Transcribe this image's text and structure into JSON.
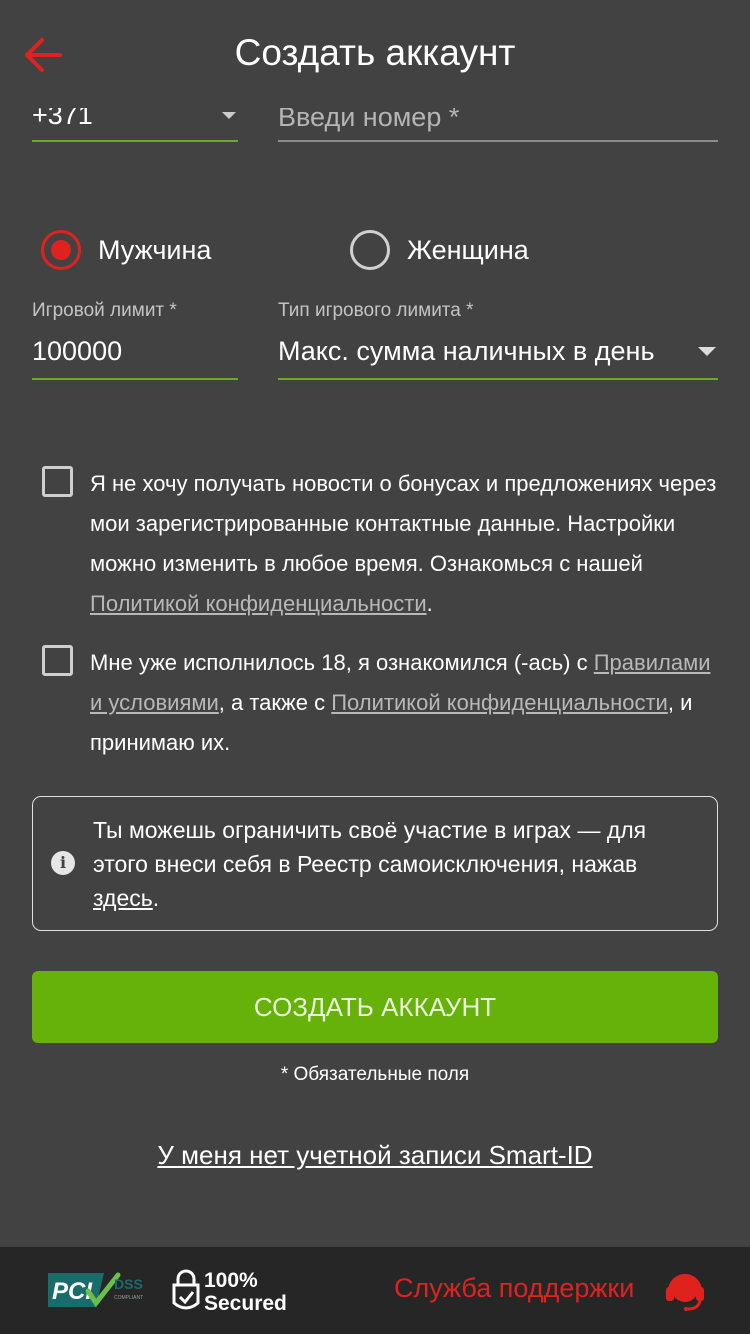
{
  "header": {
    "title": "Создать аккаунт"
  },
  "phone": {
    "code": "+371",
    "placeholder": "Введи номер *"
  },
  "gender": {
    "male_label": "Мужчина",
    "female_label": "Женщина",
    "selected": "male"
  },
  "limits": {
    "amount_label": "Игровой лимит *",
    "amount_value": "100000",
    "type_label": "Тип игрового лимита *",
    "type_value": "Макс. сумма наличных в день"
  },
  "consents": {
    "news": {
      "text_before": "Я не хочу получать новости о бонусах и предложениях через мои зарегистрированные контактные данные. Настройки можно изменить в любое время. Ознакомься с нашей ",
      "link": "Политикой конфиденциальности",
      "text_after": "."
    },
    "age": {
      "text_1": "Мне уже исполнилось 18, я ознакомился (-ась) с ",
      "link_terms": "Правилами и условиями",
      "text_2": ", а также с ",
      "link_privacy": "Политикой конфиденциальности",
      "text_3": ", и принимаю их."
    }
  },
  "info": {
    "text": "Ты можешь ограничить своё участие в играх — для этого внеси себя в Реестр самоисключения, нажав ",
    "link": "здесь",
    "text_after": "."
  },
  "actions": {
    "create_label": "СОЗДАТЬ АККАУНТ",
    "required_note": "* Обязательные поля",
    "smartid_link": "У меня нет учетной записи Smart-ID"
  },
  "footer": {
    "pci_logo_text": "PCI DSS COMPLIANT",
    "secured_logo_text": "100% Secured",
    "support_label": "Служба поддержки"
  },
  "colors": {
    "accent_red": "#e0221f",
    "accent_green": "#66b10a",
    "background": "#424242",
    "footer_bg": "#262626"
  }
}
